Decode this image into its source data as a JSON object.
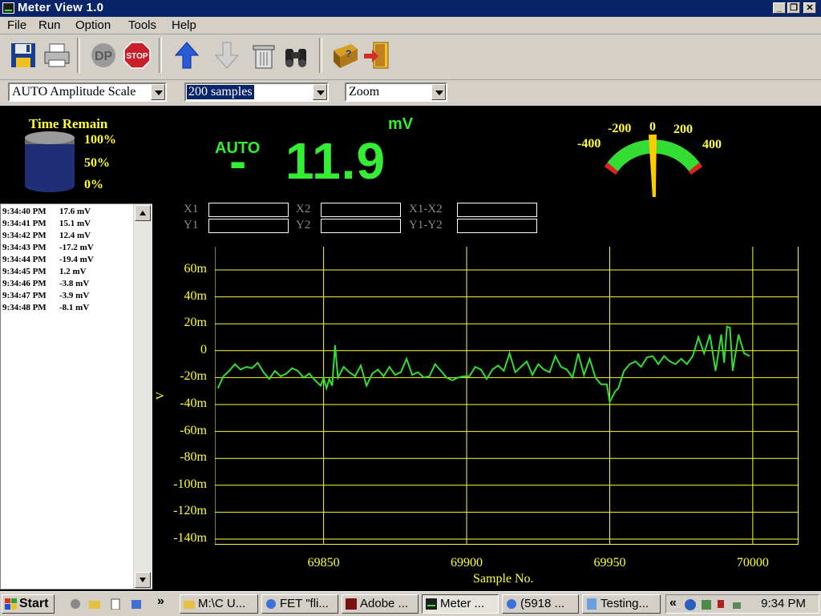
{
  "window": {
    "title": "Meter View 1.0"
  },
  "menu": [
    "File",
    "Run",
    "Option",
    "Tools",
    "Help"
  ],
  "toolbar": {
    "icons": [
      "save-icon",
      "print-icon",
      "dp-logo-icon",
      "stop-icon",
      "arrow-up-icon",
      "arrow-down-icon",
      "trash-icon",
      "binoculars-icon",
      "help-book-icon",
      "exit-door-icon"
    ],
    "stop_label": "STOP"
  },
  "controls": {
    "amplitude_scale": "AUTO Amplitude Scale",
    "samples": "200 samples",
    "zoom": "Zoom"
  },
  "time_remain": {
    "label": "Time Remain",
    "levels": [
      "100%",
      "50%",
      "0%"
    ]
  },
  "display": {
    "unit": "mV",
    "mode": "AUTO",
    "sign": "-",
    "value": "11.9"
  },
  "gauge": {
    "ticks": [
      "-400",
      "-200",
      "0",
      "200",
      "400"
    ],
    "needle_value": -11.9,
    "range": [
      -500,
      500
    ]
  },
  "log": [
    {
      "time": "9:34:40 PM",
      "value": "17.6 mV"
    },
    {
      "time": "9:34:41 PM",
      "value": "15.1 mV"
    },
    {
      "time": "9:34:42 PM",
      "value": "12.4 mV"
    },
    {
      "time": "9:34:43 PM",
      "value": "-17.2 mV"
    },
    {
      "time": "9:34:44 PM",
      "value": "-19.4 mV"
    },
    {
      "time": "9:34:45 PM",
      "value": "1.2 mV"
    },
    {
      "time": "9:34:46 PM",
      "value": "-3.8 mV"
    },
    {
      "time": "9:34:47 PM",
      "value": "-3.9 mV"
    },
    {
      "time": "9:34:48 PM",
      "value": "-8.1 mV"
    }
  ],
  "cursors": {
    "x1": "X1",
    "x2": "X2",
    "x1x2": "X1-X2",
    "y1": "Y1",
    "y2": "Y2",
    "y1y2": "Y1-Y2"
  },
  "chart_data": {
    "type": "line",
    "xlabel": "Sample No.",
    "ylabel": "V",
    "xlim": [
      69812,
      70016
    ],
    "ylim": [
      -0.14,
      0.06
    ],
    "x_ticks": [
      69850,
      69900,
      69950,
      70000
    ],
    "y_ticks": [
      0.06,
      0.04,
      0.02,
      0,
      -0.02,
      -0.04,
      -0.06,
      -0.08,
      -0.1,
      -0.12,
      -0.14
    ],
    "y_tick_labels": [
      "60m",
      "40m",
      "20m",
      "0",
      "-20m",
      "-40m",
      "-60m",
      "-80m",
      "-100m",
      "-120m",
      "-140m"
    ],
    "grid": true,
    "line_color": "#33dd33",
    "x": [
      69813,
      69815,
      69817,
      69819,
      69821,
      69823,
      69825,
      69827,
      69829,
      69831,
      69833,
      69835,
      69837,
      69839,
      69841,
      69843,
      69845,
      69847,
      69849,
      69850,
      69851,
      69852,
      69853,
      69854,
      69855,
      69857,
      69859,
      69861,
      69863,
      69865,
      69867,
      69869,
      69871,
      69873,
      69875,
      69877,
      69879,
      69881,
      69883,
      69885,
      69887,
      69889,
      69891,
      69893,
      69895,
      69897,
      69899,
      69901,
      69903,
      69905,
      69907,
      69909,
      69911,
      69913,
      69915,
      69917,
      69919,
      69921,
      69923,
      69925,
      69927,
      69929,
      69931,
      69933,
      69935,
      69937,
      69939,
      69941,
      69943,
      69945,
      69947,
      69949,
      69950,
      69951,
      69952,
      69953,
      69955,
      69957,
      69959,
      69961,
      69963,
      69965,
      69967,
      69969,
      69971,
      69973,
      69975,
      69977,
      69979,
      69981,
      69983,
      69985,
      69987,
      69989,
      69990,
      69991,
      69992,
      69993,
      69995,
      69997,
      69999
    ],
    "y": [
      -0.028,
      -0.019,
      -0.015,
      -0.01,
      -0.014,
      -0.012,
      -0.013,
      -0.009,
      -0.016,
      -0.021,
      -0.015,
      -0.019,
      -0.017,
      -0.013,
      -0.015,
      -0.02,
      -0.017,
      -0.022,
      -0.026,
      -0.02,
      -0.028,
      -0.021,
      -0.026,
      0.004,
      -0.02,
      -0.012,
      -0.016,
      -0.019,
      -0.011,
      -0.026,
      -0.017,
      -0.014,
      -0.019,
      -0.012,
      -0.018,
      -0.016,
      -0.006,
      -0.018,
      -0.016,
      -0.02,
      -0.019,
      -0.01,
      -0.015,
      -0.02,
      -0.022,
      -0.02,
      -0.019,
      -0.019,
      -0.012,
      -0.014,
      -0.021,
      -0.014,
      -0.011,
      -0.015,
      -0.002,
      -0.016,
      -0.012,
      -0.008,
      -0.018,
      -0.01,
      -0.014,
      -0.016,
      -0.004,
      -0.012,
      -0.014,
      -0.02,
      -0.002,
      -0.018,
      -0.006,
      -0.02,
      -0.025,
      -0.025,
      -0.038,
      -0.034,
      -0.03,
      -0.028,
      -0.015,
      -0.01,
      -0.008,
      -0.012,
      -0.005,
      -0.004,
      -0.01,
      -0.004,
      -0.008,
      -0.01,
      -0.006,
      -0.01,
      -0.004,
      0.01,
      -0.002,
      0.012,
      -0.015,
      0.012,
      -0.009,
      0.018,
      0.017,
      -0.015,
      0.012,
      -0.002,
      -0.004
    ]
  },
  "taskbar": {
    "start": "Start",
    "overflow": "»",
    "tasks": [
      "M:\\C U...",
      "FET \"fli...",
      "Adobe ...",
      "Meter ...",
      "(5918 ...",
      "Testing..."
    ],
    "tray_expand": "«",
    "clock": "9:34 PM"
  }
}
